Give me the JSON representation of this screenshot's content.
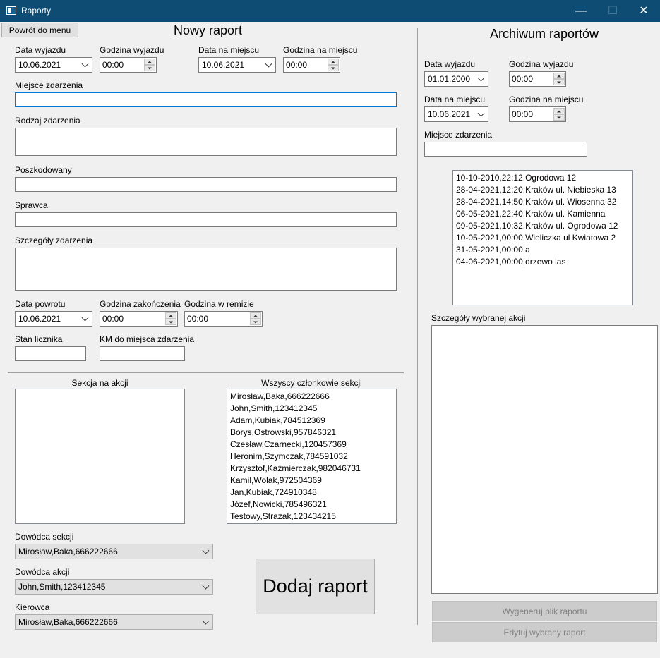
{
  "window": {
    "title": "Raporty",
    "minimize_glyph": "—",
    "maximize_glyph": "☐",
    "close_glyph": "✕"
  },
  "new_report": {
    "back_button": "Powrót do menu",
    "heading": "Nowy raport",
    "departure_date_label": "Data wyjazdu",
    "departure_date_value": "10.06.2021",
    "departure_time_label": "Godzina wyjazdu",
    "departure_time_value": "00:00",
    "arrival_date_label": "Data na miejscu",
    "arrival_date_value": "10.06.2021",
    "arrival_time_label": "Godzina na miejscu",
    "arrival_time_value": "00:00",
    "location_label": "Miejsce zdarzenia",
    "location_value": "",
    "incident_type_label": "Rodzaj zdarzenia",
    "incident_type_value": "",
    "victim_label": "Poszkodowany",
    "victim_value": "",
    "perpetrator_label": "Sprawca",
    "perpetrator_value": "",
    "details_label": "Szczegóły zdarzenia",
    "details_value": "",
    "return_date_label": "Data powrotu",
    "return_date_value": "10.06.2021",
    "end_time_label": "Godzina zakończenia",
    "end_time_value": "00:00",
    "station_time_label": "Godzina w remizie",
    "station_time_value": "00:00",
    "odometer_label": "Stan licznika",
    "odometer_value": "",
    "km_label": "KM do miejsca zdarzenia",
    "km_value": "",
    "section_on_action_label": "Sekcja na akcji",
    "section_on_action_items": [],
    "all_members_label": "Wszyscy członkowie sekcji",
    "all_members_items": [
      "Mirosław,Baka,666222666",
      "John,Smith,123412345",
      "Adam,Kubiak,784512369",
      "Borys,Ostrowski,957846321",
      "Czesław,Czarnecki,120457369",
      "Heronim,Szymczak,784591032",
      "Krzysztof,Kaźmierczak,982046731",
      "Kamil,Wolak,972504369",
      "Jan,Kubiak,724910348",
      "Józef,Nowicki,785496321",
      "Testowy,Strażak,123434215"
    ],
    "section_commander_label": "Dowódca sekcji",
    "section_commander_value": "Mirosław,Baka,666222666",
    "action_commander_label": "Dowódca akcji",
    "action_commander_value": "John,Smith,123412345",
    "driver_label": "Kierowca",
    "driver_value": "Mirosław,Baka,666222666",
    "add_button": "Dodaj raport"
  },
  "archive": {
    "heading": "Archiwum raportów",
    "departure_date_label": "Data wyjazdu",
    "departure_date_value": "01.01.2000",
    "departure_time_label": "Godzina wyjazdu",
    "departure_time_value": "00:00",
    "arrival_date_label": "Data na miejscu",
    "arrival_date_value": "10.06.2021",
    "arrival_time_label": "Godzina na miejscu",
    "arrival_time_value": "00:00",
    "location_label": "Miejsce zdarzenia",
    "location_value": "",
    "reports": [
      "10-10-2010,22:12,Ogrodowa 12",
      "28-04-2021,12:20,Kraków ul. Niebieska 13",
      "28-04-2021,14:50,Kraków ul. Wiosenna 32",
      "06-05-2021,22:40,Kraków ul. Kamienna",
      "09-05-2021,10:32,Kraków ul. Ogrodowa 12",
      "10-05-2021,00:00,Wieliczka ul Kwiatowa 2",
      "31-05-2021,00:00,a",
      "04-06-2021,00:00,drzewo las"
    ],
    "selected_details_label": "Szczegóły wybranej akcji",
    "selected_details_value": "",
    "generate_button": "Wygeneruj plik raportu",
    "edit_button": "Edytuj wybrany raport"
  }
}
